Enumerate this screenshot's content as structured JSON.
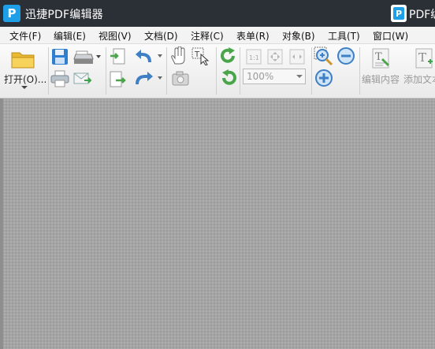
{
  "window": {
    "title": "迅捷PDF编辑器",
    "logo_letter": "P",
    "second_window_title_partial": "PDF编"
  },
  "menu": [
    "文件(F)",
    "编辑(E)",
    "视图(V)",
    "文档(D)",
    "注释(C)",
    "表单(R)",
    "对象(B)",
    "工具(T)",
    "窗口(W)"
  ],
  "toolbar": {
    "open_label": "打开(O)...",
    "zoom_value": "100%",
    "edit_content_label": "编辑内容",
    "add_text_label": "添加文本"
  },
  "colors": {
    "titlebar": "#2b2f36",
    "brand_blue": "#1fa0e6",
    "canvas_gray": "#a5a5a5"
  }
}
